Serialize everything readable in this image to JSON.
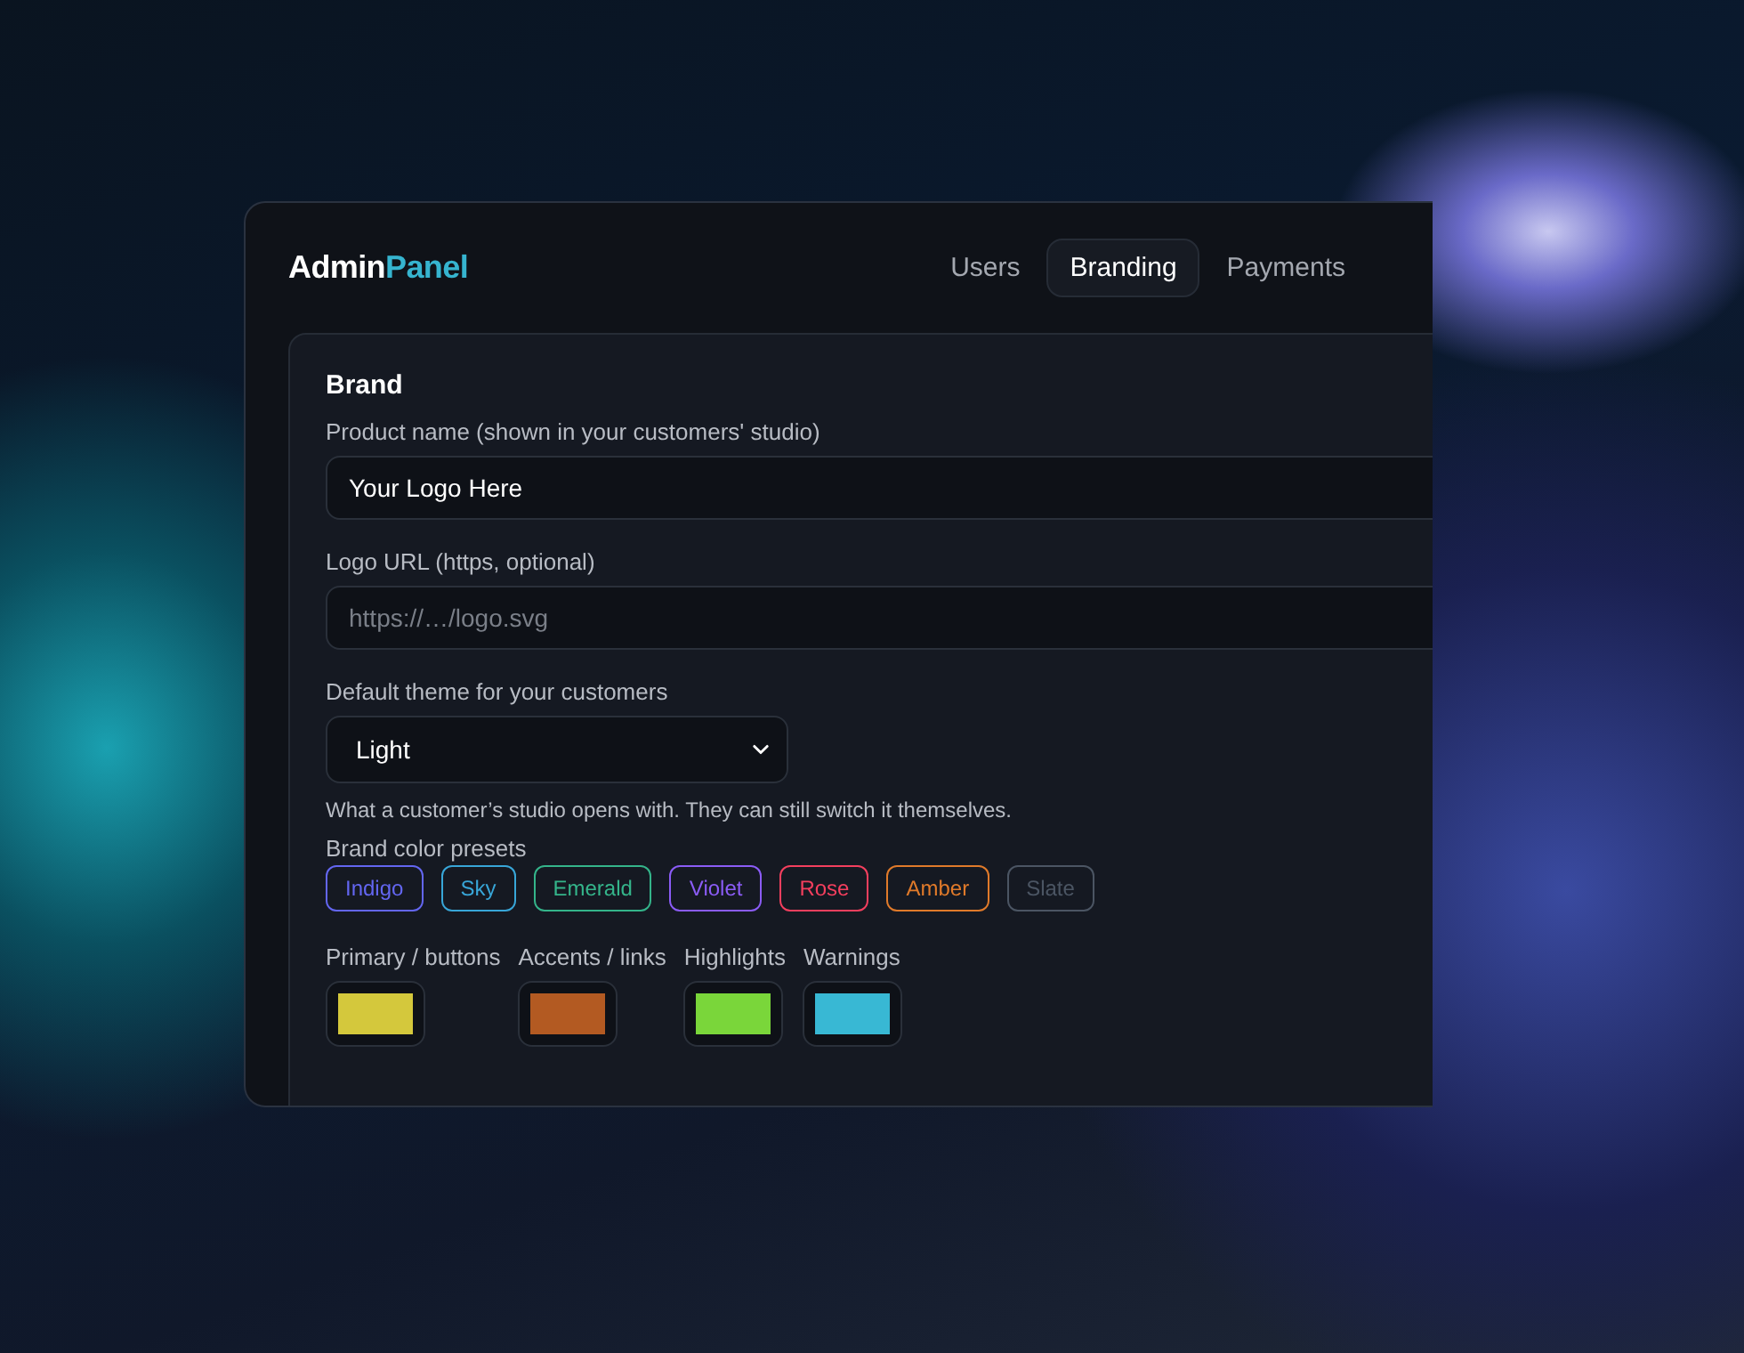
{
  "header": {
    "logo_primary": "Admin",
    "logo_accent": "Panel"
  },
  "tabs": [
    {
      "label": "Users",
      "selected": false
    },
    {
      "label": "Branding",
      "selected": true
    },
    {
      "label": "Payments",
      "selected": false
    }
  ],
  "brand": {
    "title": "Brand",
    "product_name": {
      "label": "Product name (shown in your customers' studio)",
      "value": "Your Logo Here"
    },
    "logo_url": {
      "label": "Logo URL (https, optional)",
      "placeholder": "https://…/logo.svg"
    },
    "theme": {
      "label": "Default theme for your customers",
      "value": "Light",
      "help": "What a customer’s studio opens with. They can still switch it themselves."
    },
    "presets_label": "Brand color presets",
    "presets": [
      {
        "label": "Indigo",
        "color": "#6366f1"
      },
      {
        "label": "Sky",
        "color": "#38a6d8"
      },
      {
        "label": "Emerald",
        "color": "#34b48a"
      },
      {
        "label": "Violet",
        "color": "#8b5cf6"
      },
      {
        "label": "Rose",
        "color": "#f43f5e"
      },
      {
        "label": "Amber",
        "color": "#e07a2a"
      },
      {
        "label": "Slate",
        "color": "#4b5563"
      }
    ],
    "colors": [
      {
        "label": "Primary / buttons",
        "color": "#d4c83c"
      },
      {
        "label": "Accents / links",
        "color": "#b35a22"
      },
      {
        "label": "Highlights",
        "color": "#7ad63a"
      },
      {
        "label": "Warnings",
        "color": "#38b8d4"
      }
    ]
  }
}
